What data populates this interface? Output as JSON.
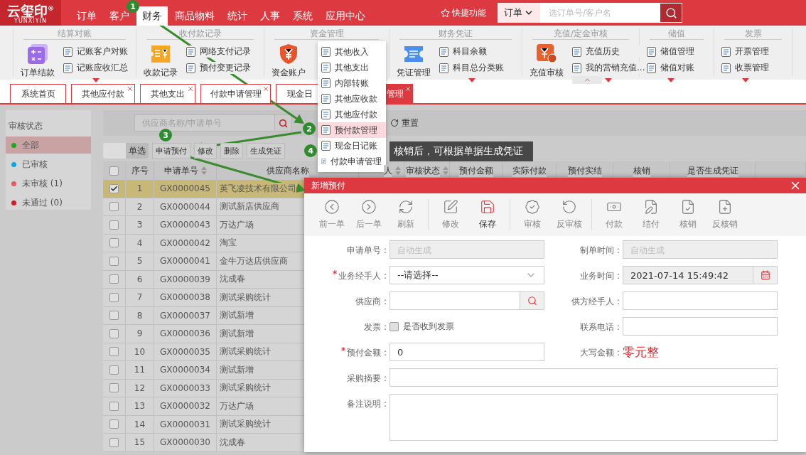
{
  "header": {
    "logo": {
      "name": "云玺印",
      "mark": "®",
      "sub": "YUNXIYIN"
    },
    "nav": [
      {
        "label": "订单",
        "selected": false
      },
      {
        "label": "客户",
        "selected": false
      },
      {
        "label": "财务",
        "selected": true
      },
      {
        "label": "商品物料",
        "selected": false
      },
      {
        "label": "统计",
        "selected": false
      },
      {
        "label": "人事",
        "selected": false
      },
      {
        "label": "系统",
        "selected": false
      },
      {
        "label": "应用中心",
        "selected": false
      }
    ],
    "quick": "快捷功能",
    "search": {
      "scope": "订单",
      "placeholder": "选订单号/客户名"
    }
  },
  "ribbon": [
    {
      "title": "结算对账",
      "main": {
        "label": "订单结款",
        "kind": "calc"
      },
      "links": [
        "记账客户对账",
        "记账应收汇总"
      ],
      "more": true
    },
    {
      "title": "收付款记录",
      "main": {
        "label": "收款记录",
        "kind": "ticket"
      },
      "links": [
        "网络支付记录",
        "预付变更记录"
      ],
      "more": false
    },
    {
      "title": "资金管理",
      "main": {
        "label": "资金账户",
        "kind": "shield"
      },
      "more": false
    },
    {
      "title": "财务凭证",
      "main": {
        "label": "凭证管理",
        "kind": "voucher"
      },
      "links": [
        "科目余额",
        "科目总分类账"
      ],
      "more": true
    },
    {
      "title": "充值/定金审核",
      "main": {
        "label": "充值审核",
        "kind": "stamp"
      },
      "links": [
        "充值历史",
        "我的营销充值..."
      ],
      "more": true
    },
    {
      "title": "储值",
      "links": [
        "储值管理",
        "储值对账"
      ],
      "more": true
    },
    {
      "title": "发票",
      "links": [
        "开票管理",
        "收票管理"
      ],
      "more": true
    }
  ],
  "menu": {
    "items": [
      {
        "label": "其他收入",
        "selected": false
      },
      {
        "label": "其他支出",
        "selected": false
      },
      {
        "label": "内部转账",
        "selected": false
      },
      {
        "label": "其他应收款",
        "selected": false
      },
      {
        "label": "其他应付款",
        "selected": false
      },
      {
        "label": "预付款管理",
        "selected": true
      },
      {
        "label": "现金日记账",
        "selected": false
      },
      {
        "label": "付款申请管理",
        "selected": false
      }
    ]
  },
  "tabs": [
    {
      "label": "系统首页",
      "closable": false,
      "selected": false
    },
    {
      "label": "其他应付款",
      "closable": true,
      "selected": false
    },
    {
      "label": "其他支出",
      "closable": true,
      "selected": false
    },
    {
      "label": "付款申请管理",
      "closable": true,
      "selected": false
    },
    {
      "label": "现金日",
      "closable": false,
      "selected": false
    },
    {
      "label": "管理",
      "closable": true,
      "selected": true
    }
  ],
  "sidebar": {
    "title": "审核状态",
    "items": [
      {
        "label": "全部",
        "color": "#1fa81f",
        "selected": true
      },
      {
        "label": "已审核",
        "color": "#12a4d8",
        "selected": false
      },
      {
        "label": "未审核 (1)",
        "color": "#e45a5a",
        "selected": false
      },
      {
        "label": "未通过 (0)",
        "color": "#c8202a",
        "selected": false
      }
    ]
  },
  "filter": {
    "placeholder": "供应商名称/申请单号",
    "reset": "重置"
  },
  "toolbar": {
    "mode": "单选",
    "buttons": [
      "申请预付",
      "修改",
      "删除",
      "生成凭证"
    ]
  },
  "table": {
    "header_checked": false,
    "columns": [
      {
        "label": "序号",
        "sortable": false
      },
      {
        "label": "申请单号",
        "sortable": true
      },
      {
        "label": "供应商名称",
        "sortable": false
      },
      {
        "label": "人",
        "sortable": true
      },
      {
        "label": "审核状态",
        "sortable": true
      },
      {
        "label": "预付金额",
        "sortable": false
      },
      {
        "label": "实际付款",
        "sortable": false
      },
      {
        "label": "预付实结",
        "sortable": false
      },
      {
        "label": "核销",
        "sortable": false
      },
      {
        "label": "是否生成凭证",
        "sortable": false
      }
    ],
    "rows": [
      {
        "no": "1",
        "code": "GX0000045",
        "supplier": "英飞凌技术有限公司",
        "checked": true,
        "selected": true
      },
      {
        "no": "2",
        "code": "GX0000044",
        "supplier": "测试新店供应商",
        "checked": false,
        "selected": false
      },
      {
        "no": "3",
        "code": "GX0000043",
        "supplier": "万达广场",
        "checked": false,
        "selected": false
      },
      {
        "no": "4",
        "code": "GX0000042",
        "supplier": "淘宝",
        "checked": false,
        "selected": false
      },
      {
        "no": "5",
        "code": "GX0000041",
        "supplier": "金牛万达店供应商",
        "checked": false,
        "selected": false
      },
      {
        "no": "6",
        "code": "GX0000039",
        "supplier": "沈成春",
        "checked": false,
        "selected": false
      },
      {
        "no": "7",
        "code": "GX0000038",
        "supplier": "测试采购统计",
        "checked": false,
        "selected": false
      },
      {
        "no": "8",
        "code": "GX0000037",
        "supplier": "测试新增",
        "checked": false,
        "selected": false
      },
      {
        "no": "9",
        "code": "GX0000036",
        "supplier": "测试新增",
        "checked": false,
        "selected": false
      },
      {
        "no": "10",
        "code": "GX0000035",
        "supplier": "测试采购统计",
        "checked": false,
        "selected": false
      },
      {
        "no": "11",
        "code": "GX0000034",
        "supplier": "测试新增",
        "checked": false,
        "selected": false
      },
      {
        "no": "12",
        "code": "GX0000033",
        "supplier": "测试采购统计",
        "checked": false,
        "selected": false
      },
      {
        "no": "13",
        "code": "GX0000032",
        "supplier": "万达广场",
        "checked": false,
        "selected": false
      },
      {
        "no": "14",
        "code": "GX0000031",
        "supplier": "测试采购统计",
        "checked": false,
        "selected": false
      },
      {
        "no": "15",
        "code": "GX0000030",
        "supplier": "沈成春",
        "checked": false,
        "selected": false
      }
    ]
  },
  "modal": {
    "title": "新增预付",
    "tool_groups": [
      [
        {
          "label": "前一单",
          "kind": "prev",
          "disabled": true
        },
        {
          "label": "后一单",
          "kind": "next",
          "disabled": true
        },
        {
          "label": "刷新",
          "kind": "refresh",
          "disabled": true
        }
      ],
      [
        {
          "label": "修改",
          "kind": "edit",
          "disabled": true
        },
        {
          "label": "保存",
          "kind": "save",
          "disabled": false
        }
      ],
      [
        {
          "label": "审核",
          "kind": "audit",
          "disabled": true
        },
        {
          "label": "反审核",
          "kind": "unaudit",
          "disabled": true
        }
      ],
      [
        {
          "label": "付款",
          "kind": "pay",
          "disabled": true
        },
        {
          "label": "结付",
          "kind": "settle",
          "disabled": true
        },
        {
          "label": "核销",
          "kind": "writeoff",
          "disabled": true
        },
        {
          "label": "反核销",
          "kind": "unwriteoff",
          "disabled": true
        }
      ]
    ],
    "fields": [
      {
        "label": "申请单号 :",
        "kind": "readonly",
        "placeholder": "自动生成",
        "required": false
      },
      {
        "label": "制单时间 :",
        "kind": "readonly",
        "placeholder": "自动生成",
        "required": false
      },
      {
        "label": "业务经手人 :",
        "kind": "select",
        "value": "--请选择--",
        "required": true
      },
      {
        "label": "业务时间 :",
        "kind": "date",
        "value": "2021-07-14 15:49:42",
        "required": false
      },
      {
        "label": "供应商 :",
        "kind": "lookup",
        "required": false
      },
      {
        "label": "供方经手人 :",
        "kind": "text",
        "required": false
      },
      {
        "label": "发票 :",
        "kind": "checkbox",
        "text": "是否收到发票",
        "checked": false,
        "required": false
      },
      {
        "label": "联系电话 :",
        "kind": "text",
        "required": false
      },
      {
        "label": "预付金额 :",
        "kind": "text",
        "value": "0",
        "required": true
      },
      {
        "label": "大写金额 :",
        "kind": "static",
        "value": "零元整",
        "required": false
      },
      {
        "label": "采购摘要 :",
        "kind": "wide",
        "required": false
      },
      {
        "label": "备注说明 :",
        "kind": "textarea",
        "required": false
      }
    ]
  },
  "annotations": {
    "markers": [
      "1",
      "2",
      "3",
      "4"
    ],
    "tooltip": "核销后，可根据单据生成凭证"
  }
}
